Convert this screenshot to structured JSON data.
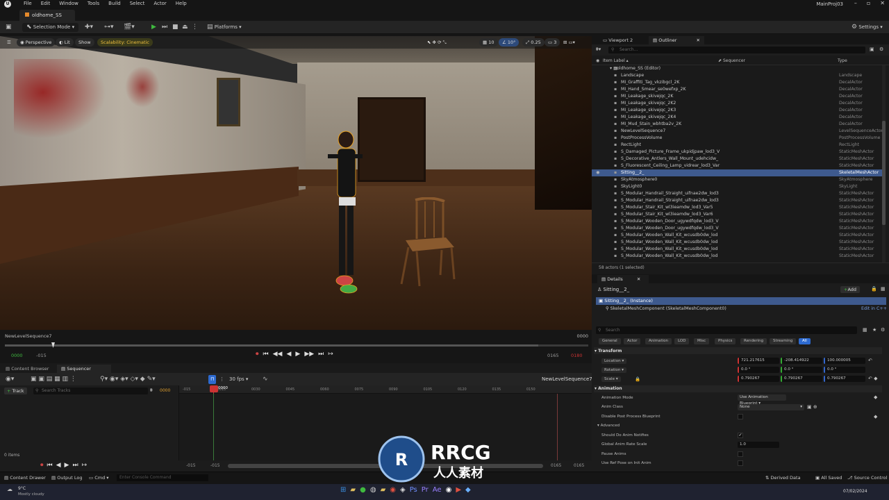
{
  "menu": {
    "items": [
      "File",
      "Edit",
      "Window",
      "Tools",
      "Build",
      "Select",
      "Actor",
      "Help"
    ],
    "project": "MainProj03"
  },
  "level_tab": "oldhome_SS",
  "toolbar": {
    "selection_mode": "Selection Mode",
    "platforms": "Platforms",
    "settings": "Settings"
  },
  "viewport": {
    "perspective": "Perspective",
    "lit": "Lit",
    "show": "Show",
    "scalability": "Scalability: Cinematic",
    "grid": "10",
    "angle": "10°",
    "scale": "0.25",
    "cam": "3"
  },
  "playbar": {
    "sequence": "NewLevelSequence7",
    "frame_right": "0000",
    "start": "0000",
    "start_neg": "-015",
    "end": "0165",
    "end_red": "0180",
    "progress": 0.914
  },
  "seq_tabs": {
    "content_browser": "Content Browser",
    "sequencer": "Sequencer"
  },
  "sequencer": {
    "fps": "30 fps",
    "seq_name": "NewLevelSequence7",
    "track": "Track",
    "search": "Search Tracks",
    "current": "0000",
    "items": "0 items",
    "ticks": [
      "-015",
      "0015",
      "0030",
      "0045",
      "0060",
      "0075",
      "0090",
      "0105",
      "0120",
      "0135",
      "0150"
    ],
    "footer": {
      "left1": "-015",
      "left2": "-015",
      "right1": "0165",
      "right2": "0165"
    }
  },
  "statusbar": {
    "content_drawer": "Content Drawer",
    "output_log": "Output Log",
    "cmd": "Cmd",
    "console_placeholder": "Enter Console Command",
    "derived": "Derived Data",
    "saved": "All Saved",
    "source": "Source Control"
  },
  "taskbar": {
    "temp": "9°C",
    "weather": "Mostly cloudy",
    "date": "07/02/2024"
  },
  "outliner": {
    "tab_viewport": "Viewport 2",
    "tab_outliner": "Outliner",
    "search": "Search...",
    "col_label": "Item Label",
    "col_seq": "Sequencer",
    "col_type": "Type",
    "root": "oldhome_SS (Editor)",
    "rows": [
      [
        "Landscape",
        "Landscape"
      ],
      [
        "MI_Graffiti_Tag_vkzibgcl_2K",
        "DecalActor"
      ],
      [
        "MI_Hand_Smear_se0wefxp_2K",
        "DecalActor"
      ],
      [
        "MI_Leakage_skivejqc_2K",
        "DecalActor"
      ],
      [
        "MI_Leakage_skivejqc_2K2",
        "DecalActor"
      ],
      [
        "MI_Leakage_skivejqc_2K3",
        "DecalActor"
      ],
      [
        "MI_Leakage_skivejqc_2K4",
        "DecalActor"
      ],
      [
        "MI_Mud_Stain_wbhtba2v_2K",
        "DecalActor"
      ],
      [
        "NewLevelSequence7",
        "LevelSequenceActor"
      ],
      [
        "PostProcessVolume",
        "PostProcessVolume"
      ],
      [
        "RectLight",
        "RectLight"
      ],
      [
        "S_Damaged_Picture_Frame_ukpidjpaw_lod3_V",
        "StaticMeshActor"
      ],
      [
        "S_Decorative_Antlers_Wall_Mount_udehcidw_",
        "StaticMeshActor"
      ],
      [
        "S_Fluorescent_Ceiling_Lamp_vidrear_lod3_Var",
        "StaticMeshActor"
      ],
      [
        "Sitting__2_",
        "SkeletalMeshActor"
      ],
      [
        "SkyAtmosphere0",
        "SkyAtmosphere"
      ],
      [
        "SkyLight0",
        "SkyLight"
      ],
      [
        "S_Modular_Handrail_Straight_uifnae2dw_lod3",
        "StaticMeshActor"
      ],
      [
        "S_Modular_Handrail_Straight_uifnae2dw_lod3",
        "StaticMeshActor"
      ],
      [
        "S_Modular_Stair_Kit_wl3ieamdw_lod3_Var5",
        "StaticMeshActor"
      ],
      [
        "S_Modular_Stair_Kit_wl3ieamdw_lod3_Var6",
        "StaticMeshActor"
      ],
      [
        "S_Modular_Wooden_Door_ugywdfqdw_lod3_V",
        "StaticMeshActor"
      ],
      [
        "S_Modular_Wooden_Door_ugywdfqdw_lod3_V",
        "StaticMeshActor"
      ],
      [
        "S_Modular_Wooden_Wall_Kit_wcusdb0dw_lod",
        "StaticMeshActor"
      ],
      [
        "S_Modular_Wooden_Wall_Kit_wcusdb0dw_lod",
        "StaticMeshActor"
      ],
      [
        "S_Modular_Wooden_Wall_Kit_wcusdb0dw_lod",
        "StaticMeshActor"
      ],
      [
        "S_Modular_Wooden_Wall_Kit_wcusdb0dw_lod",
        "StaticMeshActor"
      ]
    ],
    "selected_index": 14,
    "footer": "58 actors (1 selected)"
  },
  "details": {
    "tab": "Details",
    "name": "Sitting__2_",
    "add": "Add",
    "instance": "Sitting__2_ (Instance)",
    "component": "SkeletalMeshComponent (SkeletalMeshComponent0)",
    "edit_cpp": "Edit in C++",
    "search": "Search",
    "categories": [
      "General",
      "Actor",
      "Animation",
      "LOD",
      "Misc",
      "Physics",
      "Rendering",
      "Streaming",
      "All"
    ],
    "transform": "Transform",
    "location": "Location",
    "rotation": "Rotation",
    "scale": "Scale",
    "loc": [
      "721.217615",
      "-208.414922",
      "100.000005"
    ],
    "rot": [
      "0.0 °",
      "0.0 °",
      "0.0 °"
    ],
    "scl": [
      "0.790267",
      "0.790267",
      "0.790267"
    ],
    "animation": "Animation",
    "anim_mode_label": "Animation Mode",
    "anim_mode": "Use Animation Blueprint",
    "anim_class_label": "Anim Class",
    "anim_class": "None",
    "disable_pp": "Disable Post Process Blueprint",
    "advanced": "Advanced",
    "should_do": "Should Do Anim Notifies",
    "global_rate": "Global Anim Rate Scale",
    "global_rate_val": "1.0",
    "pause": "Pause Anims",
    "use_ref": "Use Ref Pose on Init Anim"
  },
  "watermark": {
    "brand": "RRCG",
    "sub": "人人素材"
  }
}
